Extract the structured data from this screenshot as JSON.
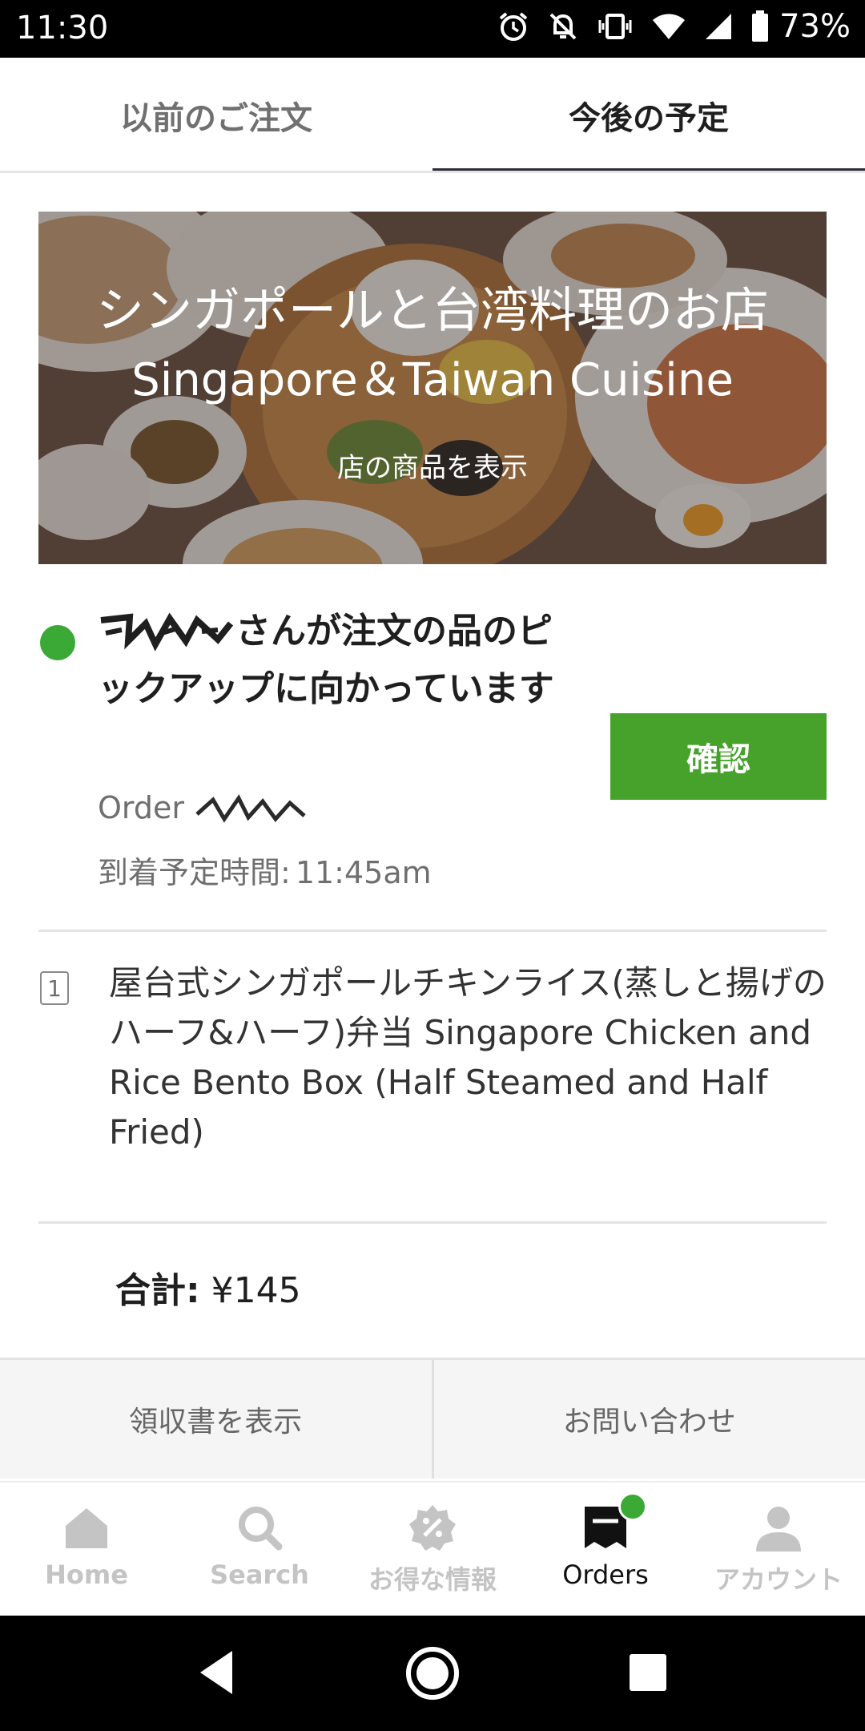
{
  "status_bar": {
    "time": "11:30",
    "battery": "73%",
    "icons": [
      "alarm-icon",
      "notifications-off-icon",
      "vibrate-icon",
      "wifi-icon",
      "signal-icon",
      "battery-icon"
    ]
  },
  "tabs": [
    {
      "label": "以前のご注文",
      "active": false
    },
    {
      "label": "今後の予定",
      "active": true
    }
  ],
  "restaurant": {
    "name_ja": "シンガポールと台湾料理のお店",
    "name_en": "Singapore＆Taiwan Cuisine",
    "view_items": "店の商品を表示"
  },
  "order": {
    "status_message": "さんが注文の品のピックアップに向かっています",
    "confirm_label": "確認",
    "number_prefix": "Order #",
    "eta_label": "到着予定時間:",
    "eta_time": "11:45am",
    "status_color": "#3aa935"
  },
  "items": [
    {
      "qty": "1",
      "name": "屋台式シンガポールチキンライス(蒸しと揚げのハーフ&ハーフ)弁当 Singapore Chicken and Rice Bento Box (Half Steamed and Half Fried)"
    }
  ],
  "total": {
    "label": "合計:",
    "value": "¥145"
  },
  "actions": {
    "receipt": "領収書を表示",
    "contact": "お問い合わせ"
  },
  "bottom_nav": [
    {
      "label": "Home",
      "icon": "home-icon",
      "active": false
    },
    {
      "label": "Search",
      "icon": "search-icon",
      "active": false
    },
    {
      "label": "お得な情報",
      "icon": "offers-icon",
      "active": false
    },
    {
      "label": "Orders",
      "icon": "orders-icon",
      "active": true
    },
    {
      "label": "アカウント",
      "icon": "account-icon",
      "active": false
    }
  ],
  "colors": {
    "accent_green": "#46a22b",
    "active_tab_underline": "#2b2b3a"
  }
}
